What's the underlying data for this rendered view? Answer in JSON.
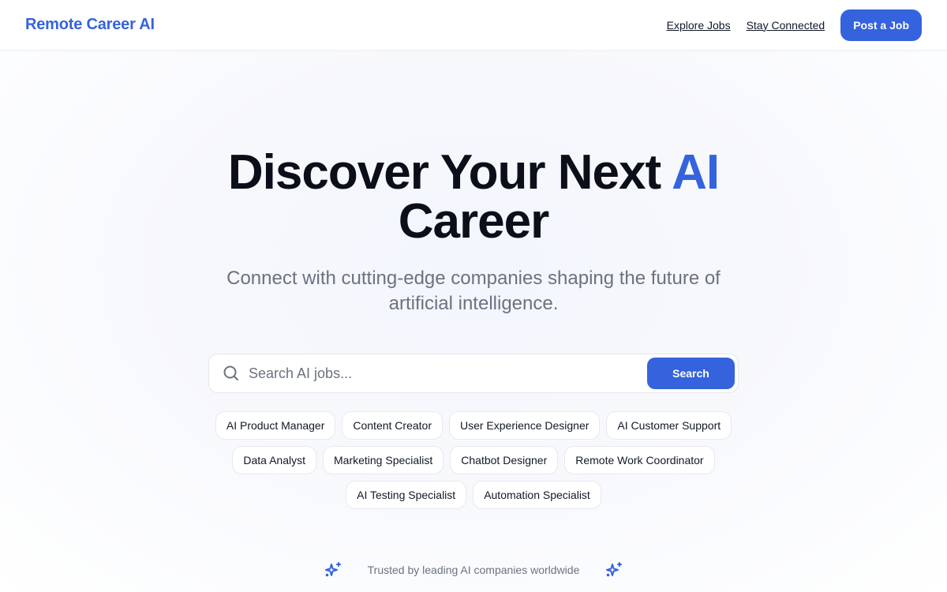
{
  "header": {
    "logo": "Remote Career AI",
    "nav": [
      {
        "label": "Explore Jobs"
      },
      {
        "label": "Stay Connected"
      }
    ],
    "cta_label": "Post a Job"
  },
  "hero": {
    "title_main": "Discover Your Next ",
    "title_accent": "AI",
    "title_line2": "Career",
    "subtitle": "Connect with cutting-edge companies shaping the future of artificial intelligence."
  },
  "search": {
    "icon": "search-icon",
    "placeholder": "Search AI jobs...",
    "value": "",
    "button_label": "Search"
  },
  "chips": [
    {
      "label": "AI Product Manager"
    },
    {
      "label": "Content Creator"
    },
    {
      "label": "User Experience Designer"
    },
    {
      "label": "AI Customer Support"
    },
    {
      "label": "Data Analyst"
    },
    {
      "label": "Marketing Specialist"
    },
    {
      "label": "Chatbot Designer"
    },
    {
      "label": "Remote Work Coordinator"
    },
    {
      "label": "AI Testing Specialist"
    },
    {
      "label": "Automation Specialist"
    }
  ],
  "trusted": {
    "icon": "sparkles-icon",
    "text": "Trusted by leading AI companies worldwide"
  },
  "colors": {
    "accent": "#3563de",
    "heading": "#0b0f1a",
    "muted": "#6b7280"
  }
}
